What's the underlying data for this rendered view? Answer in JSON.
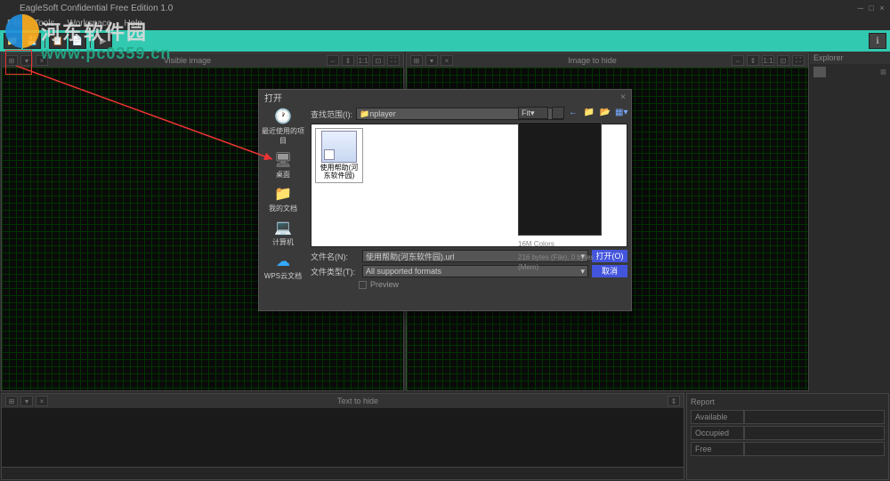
{
  "app": {
    "title": "EagleSoft Confidential Free Edition 1.0"
  },
  "menu": {
    "file": "File",
    "tools": "Tools",
    "workspace": "Workspace",
    "help": "Help"
  },
  "panels": {
    "visible": "Visible image",
    "hide": "Image to hide",
    "text": "Text to hide",
    "ratio": "1:1"
  },
  "explorer": {
    "title": "Explorer"
  },
  "report": {
    "title": "Report",
    "available": "Available",
    "occupied": "Occupied",
    "free": "Free"
  },
  "dialog": {
    "title": "打开",
    "lookin_label": "查找范围(I):",
    "lookin_value": "nplayer",
    "places": {
      "recent": "最近使用的项目",
      "desktop": "桌面",
      "mydocs": "我的文档",
      "computer": "计算机",
      "wps": "WPS云文档"
    },
    "file_label": "使用帮助(河东软件园)",
    "filename_label": "文件名(N):",
    "filename_value": "使用帮助(河东软件园).url",
    "filetype_label": "文件类型(T):",
    "filetype_value": "All supported formats",
    "open_btn": "打开(O)",
    "cancel_btn": "取消",
    "preview": "Preview"
  },
  "preview": {
    "fit": "Fit",
    "colors": "16M Colors",
    "bytes": "216 bytes (File), 0 bytes (Mem)"
  },
  "watermark": {
    "cn": "河东软件园",
    "url": "www.pc0359.cn"
  }
}
